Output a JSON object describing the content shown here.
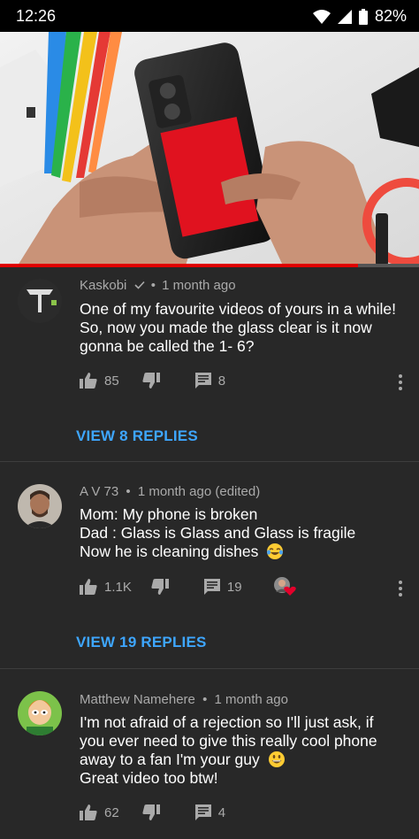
{
  "status_bar": {
    "time": "12:26",
    "battery": "82%"
  },
  "video": {
    "progress": 0.855
  },
  "comments": [
    {
      "author": "Kaskobi",
      "separator": "•",
      "time": "1 month ago",
      "lines": [
        "One of my favourite videos of yours in a while!",
        "So, now you made the glass clear is it now",
        "gonna be called the 1- 6?"
      ],
      "likes": "85",
      "replies_count": "8",
      "view_replies": "VIEW 8 REPLIES"
    },
    {
      "author": "A V 73",
      "separator": "•",
      "time": "1 month ago (edited)",
      "lines": [
        "Mom: My phone is broken",
        "Dad : Glass is Glass and Glass is fragile",
        "Now he is cleaning dishes"
      ],
      "likes": "1.1K",
      "replies_count": "19",
      "view_replies": "VIEW 19 REPLIES"
    },
    {
      "author": "Matthew Namehere",
      "separator": "•",
      "time": "1 month ago",
      "lines": [
        "I'm not afraid of a rejection so I'll just ask, if",
        "you ever need to give this really cool phone",
        "away to a fan I'm your guy",
        "Great video too btw!"
      ],
      "likes": "62",
      "replies_count": "4"
    }
  ],
  "colors": {
    "background": "#282828",
    "link": "#3ea6ff",
    "progress": "#e00000"
  }
}
